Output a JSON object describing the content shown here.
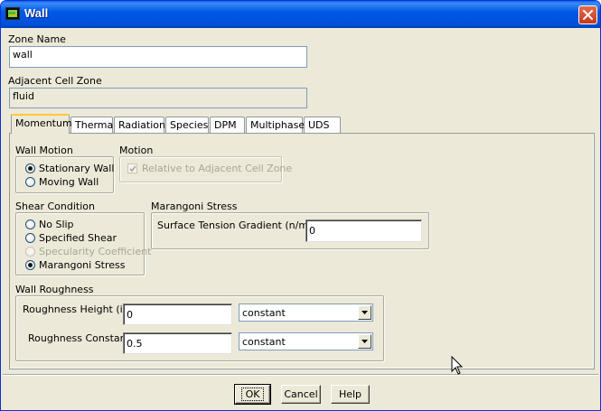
{
  "window": {
    "title": "Wall",
    "app_icon": "fluent-app-icon",
    "close_icon": "close-icon"
  },
  "zone_name": {
    "label": "Zone Name",
    "value": "wall"
  },
  "adjacent_cell_zone": {
    "label": "Adjacent Cell Zone",
    "value": "fluid"
  },
  "tabs": [
    {
      "label": "Momentum",
      "active": true
    },
    {
      "label": "Thermal",
      "active": false
    },
    {
      "label": "Radiation",
      "active": false
    },
    {
      "label": "Species",
      "active": false
    },
    {
      "label": "DPM",
      "active": false
    },
    {
      "label": "Multiphase",
      "active": false
    },
    {
      "label": "UDS",
      "active": false
    }
  ],
  "wall_motion": {
    "title": "Wall Motion",
    "options": [
      {
        "label": "Stationary Wall",
        "selected": true
      },
      {
        "label": "Moving Wall",
        "selected": false
      }
    ]
  },
  "motion": {
    "title": "Motion",
    "checkbox_label": "Relative to Adjacent Cell Zone",
    "checked": true,
    "enabled": false
  },
  "shear_condition": {
    "title": "Shear Condition",
    "options": [
      {
        "label": "No Slip",
        "selected": false,
        "enabled": true
      },
      {
        "label": "Specified Shear",
        "selected": false,
        "enabled": true
      },
      {
        "label": "Specularity Coefficient",
        "selected": false,
        "enabled": false
      },
      {
        "label": "Marangoni Stress",
        "selected": true,
        "enabled": true
      }
    ]
  },
  "marangoni_stress": {
    "title": "Marangoni Stress",
    "label": "Surface Tension Gradient (n/m-k)",
    "value": "0"
  },
  "wall_roughness": {
    "title": "Wall Roughness",
    "height": {
      "label": "Roughness Height (in)",
      "value": "0",
      "method": "constant"
    },
    "constant": {
      "label": "Roughness Constant",
      "value": "0.5",
      "method": "constant"
    }
  },
  "buttons": {
    "ok": "OK",
    "cancel": "Cancel",
    "help": "Help"
  }
}
